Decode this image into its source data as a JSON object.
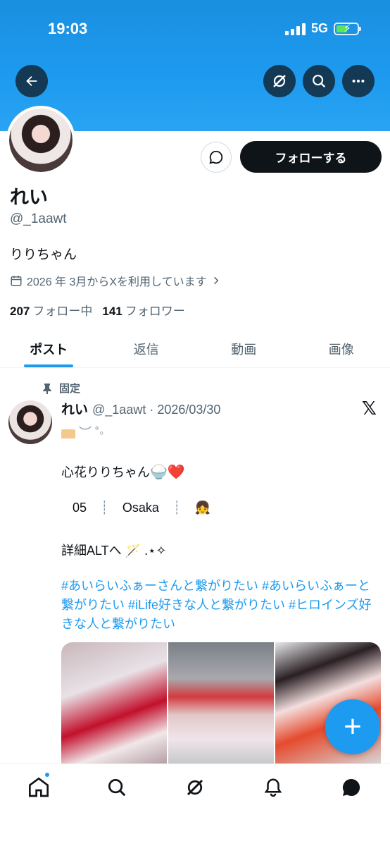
{
  "status_bar": {
    "time": "19:03",
    "network": "5G"
  },
  "profile": {
    "name": "れい",
    "handle": "@_1aawt",
    "bio": "りりちゃん",
    "joined": "2026 年 3月からXを利用しています",
    "following_count": "207",
    "following_label": "フォロー中",
    "followers_count": "141",
    "followers_label": "フォロワー",
    "follow_button": "フォローする"
  },
  "tabs": [
    {
      "label": "ポスト",
      "active": true
    },
    {
      "label": "返信",
      "active": false
    },
    {
      "label": "動画",
      "active": false
    },
    {
      "label": "画像",
      "active": false
    }
  ],
  "post": {
    "pinned_label": "固定",
    "author": "れい",
    "meta": "@_1aawt · 2026/03/30",
    "deco_line": "︶ ˚◦",
    "line1": "心花りりちゃん",
    "line1_emoji": "🍚❤️",
    "number": "05",
    "city": "Osaka",
    "city_emoji": "👧",
    "line3": "詳細ALTへ 🪄 .⋆✧",
    "hashtags": "#あいらいふぁーさんと繋がりたい  #あいらいふぁーと繋がりたい  #iLife好きな人と繋がりたい  #ヒロインズ好きな人と繋がりたい"
  },
  "fab_label": "+",
  "colors": {
    "accent": "#1d9bf0",
    "text": "#0f1419",
    "muted": "#536471"
  }
}
